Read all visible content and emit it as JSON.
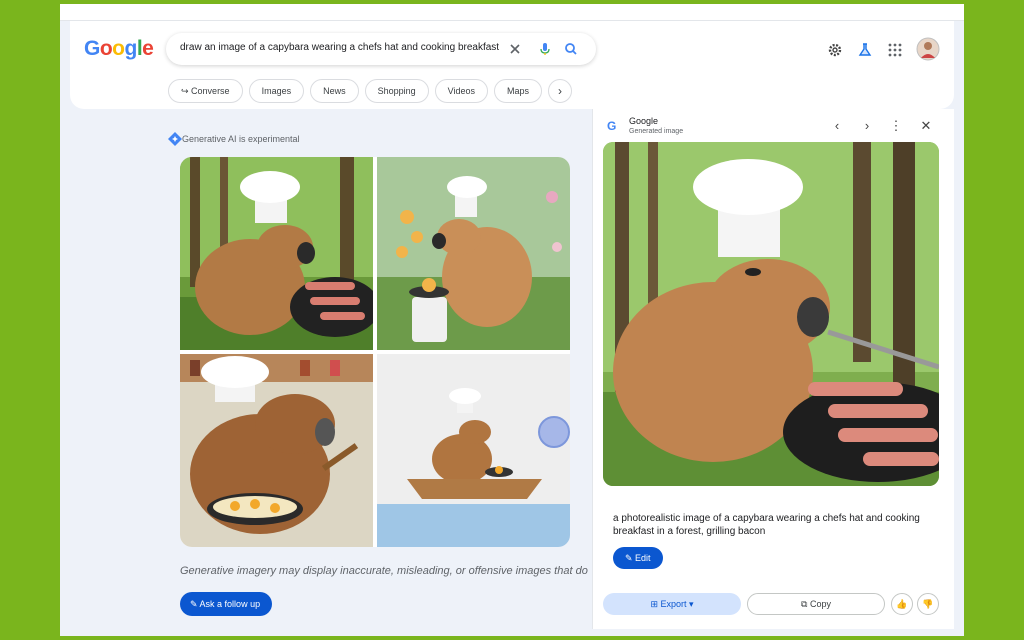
{
  "search": {
    "query": "draw an image of a capybara wearing a chefs hat and cooking breakfast"
  },
  "logo": {
    "letters": [
      "G",
      "o",
      "o",
      "g",
      "l",
      "e"
    ],
    "colors": [
      "#4285f4",
      "#ea4335",
      "#fbbc05",
      "#4285f4",
      "#34a853",
      "#ea4335"
    ]
  },
  "chips": [
    "Converse",
    "Images",
    "News",
    "Shopping",
    "Videos",
    "Maps"
  ],
  "main": {
    "ai_label": "Generative AI is experimental",
    "disclaimer": "Generative imagery may display inaccurate, misleading, or offensive images that do",
    "followup_label": "Ask a follow up"
  },
  "panel": {
    "source": "Google",
    "subtitle": "Generated image",
    "caption": "a photorealistic image of a capybara wearing a chefs hat and cooking breakfast in a forest, grilling bacon",
    "edit_label": "Edit",
    "export_label": "Export",
    "copy_label": "Copy"
  },
  "colors": {
    "accent": "#0b57d0",
    "frame": "#7ab51d"
  }
}
